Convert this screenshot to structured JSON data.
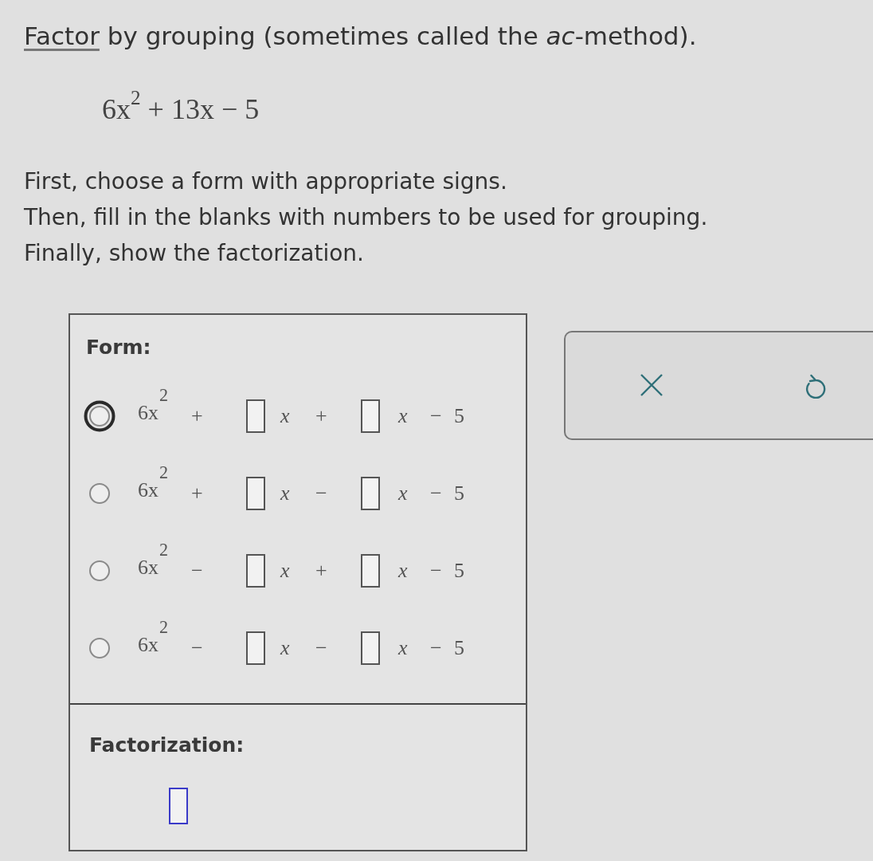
{
  "prompt": {
    "link": "Factor",
    "text": "by grouping (sometimes called the *ac*-method)."
  },
  "expression": "6x$^{2}$ + 13x − 5",
  "instructions": [
    "First, choose a form with appropriate signs.",
    "Then, fill in the blanks with numbers to be used for grouping.",
    "Finally, show the factorization."
  ],
  "form": {
    "label": "Form:",
    "options": [
      {
        "selected": false,
        "focused": true,
        "lead_term": "6x$^{2}$",
        "sign_1": "+",
        "variable_1": "x",
        "sign_2": "+",
        "variable_2": "x",
        "sign_3": "−",
        "constant": "5"
      },
      {
        "selected": false,
        "focused": false,
        "lead_term": "6x$^{2}$",
        "sign_1": "+",
        "variable_1": "x",
        "sign_2": "−",
        "variable_2": "x",
        "sign_3": "−",
        "constant": "5"
      },
      {
        "selected": false,
        "focused": false,
        "lead_term": "6x$^{2}$",
        "sign_1": "−",
        "variable_1": "x",
        "sign_2": "+",
        "variable_2": "x",
        "sign_3": "−",
        "constant": "5"
      },
      {
        "selected": false,
        "focused": false,
        "lead_term": "6x$^{2}$",
        "sign_1": "−",
        "variable_1": "x",
        "sign_2": "−",
        "variable_2": "x",
        "sign_3": "−",
        "constant": "5"
      }
    ]
  },
  "factorization": {
    "label": "Factorization:"
  }
}
